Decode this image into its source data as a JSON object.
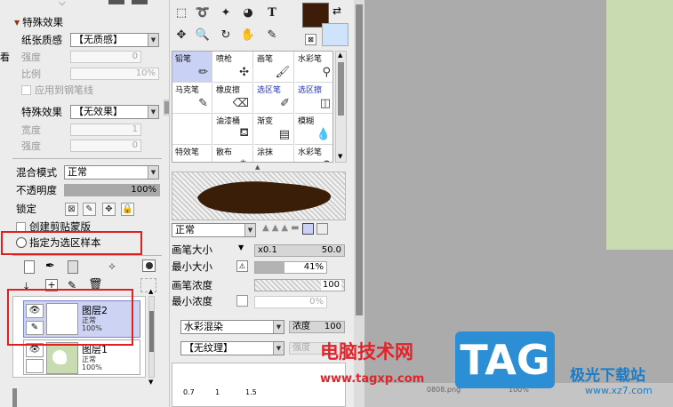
{
  "left": {
    "section_title": "特殊效果",
    "paper_texture": {
      "label": "纸张质感",
      "value": "【无质感】"
    },
    "strength1": {
      "label": "强度",
      "value": "0"
    },
    "ratio": {
      "label": "比例",
      "value": "10%"
    },
    "apply_pen": "应用到钢笔线",
    "special_effect": {
      "label": "特殊效果",
      "value": "【无效果】"
    },
    "width": {
      "label": "宽度",
      "value": "1"
    },
    "strength2": {
      "label": "强度",
      "value": "0"
    },
    "blend_mode": {
      "label": "混合模式",
      "value": "正常"
    },
    "opacity": {
      "label": "不透明度",
      "value": "100%",
      "level": 1.0
    },
    "lock": {
      "label": "锁定"
    },
    "clip_mask": "创建剪贴蒙版",
    "selection_source": "指定为选区样本",
    "side_char": "看",
    "layers": [
      {
        "name": "图层2",
        "mode": "正常",
        "opacity": "100%",
        "selected": true
      },
      {
        "name": "图层1",
        "mode": "正常",
        "opacity": "100%",
        "selected": false
      }
    ]
  },
  "mid": {
    "brushes": [
      {
        "label": "铅笔",
        "icon": "pencil-icon",
        "selected": true
      },
      {
        "label": "喷枪",
        "icon": "airbrush-icon"
      },
      {
        "label": "画笔",
        "icon": "brush-icon"
      },
      {
        "label": "水彩笔",
        "icon": "watercolor-icon"
      },
      {
        "label": "马克笔",
        "icon": "marker-icon"
      },
      {
        "label": "橡皮擦",
        "icon": "eraser-icon"
      },
      {
        "label": "选区笔",
        "icon": "selection-pen-icon",
        "blue": true
      },
      {
        "label": "选区擦",
        "icon": "selection-eraser-icon",
        "blue": true
      },
      {
        "label": "",
        "icon": ""
      },
      {
        "label": "油漆桶",
        "icon": "bucket-icon"
      },
      {
        "label": "渐变",
        "icon": "gradient-icon"
      },
      {
        "label": "模糊",
        "icon": "blur-icon"
      },
      {
        "label": "特效笔",
        "icon": "fx-pen-icon"
      },
      {
        "label": "散布",
        "icon": "scatter-icon"
      },
      {
        "label": "涂抹",
        "icon": "smudge-icon"
      },
      {
        "label": "水彩笔",
        "icon": "watercolor-icon"
      }
    ],
    "brush_mode": "正常",
    "brush_size": {
      "label": "画笔大小",
      "multiplier": "x0.1",
      "value": "50.0"
    },
    "min_size": {
      "label": "最小大小",
      "value": "41%",
      "level": 0.41
    },
    "brush_density": {
      "label": "画笔浓度",
      "value": "100"
    },
    "min_density": {
      "label": "最小浓度",
      "value": "0%"
    },
    "blend": {
      "value": "水彩混染",
      "side_label": "浓度",
      "side_value": "100"
    },
    "texture": {
      "value": "【无纹理】",
      "side_label": "强度"
    },
    "size_ticks": [
      "0.7",
      "1",
      "1.5"
    ],
    "colors": {
      "fg": "#3d1d08",
      "bg": "#cfe3fb"
    }
  },
  "watermark": {
    "site_title": "电脑技术网",
    "url": "www.tagxp.com",
    "badge": "TAG",
    "right_title": "极光下载站",
    "right_url": "www.xz7.com",
    "hidden_text": "0808.png",
    "hidden_pct": "100%"
  }
}
